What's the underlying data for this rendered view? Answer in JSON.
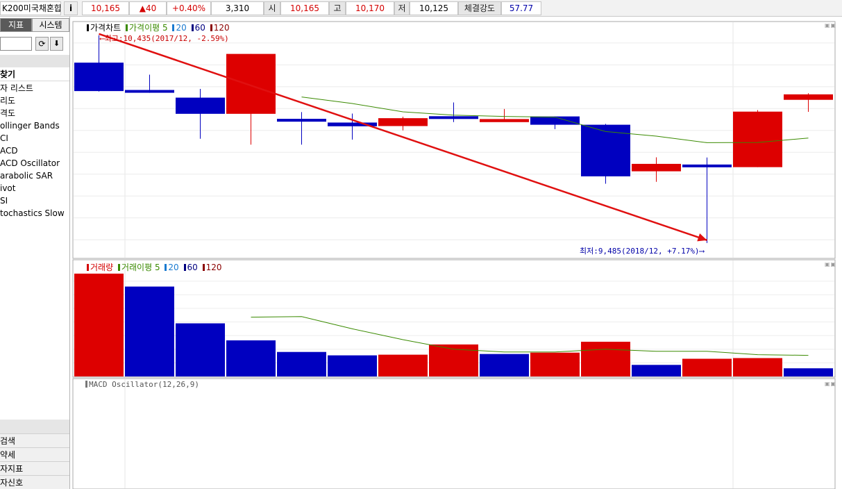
{
  "topbar": {
    "symbol": "K200미국채혼합",
    "info_button": "i",
    "price": "10,165",
    "change": "▲40",
    "change_pct": "+0.40%",
    "volume": "3,310",
    "open_label": "시",
    "open_value": "10,165",
    "high_label": "고",
    "high_value": "10,170",
    "low_label": "저",
    "low_value": "10,125",
    "strength_label": "체결강도",
    "strength_value": "57.77"
  },
  "left_panel": {
    "tabs": [
      "지표",
      "시스템"
    ],
    "section_title": "찾기",
    "items": [
      "자 리스트",
      "리도",
      "격도",
      "ollinger Bands",
      "CI",
      "ACD",
      "ACD Oscillator",
      "arabolic SAR",
      "ivot",
      "SI",
      "tochastics Slow"
    ],
    "bottom_items": [
      "검색",
      "약세",
      "자지표",
      "자신호"
    ]
  },
  "price_chart": {
    "title": "가격차트",
    "ma_label": "가격이평",
    "ma_periods": [
      "5",
      "20",
      "60",
      "120"
    ],
    "max_annotation": "최고:10,435(2017/12, -2.59%)",
    "min_annotation": "최저:9,485(2018/12, +7.17%)"
  },
  "volume_chart": {
    "title": "거래량",
    "ma_label": "거래이평",
    "ma_periods": [
      "5",
      "20",
      "60",
      "120"
    ]
  },
  "macd_chart": {
    "title": "MACD Oscillator(12,26,9)"
  },
  "colors": {
    "up": "#dd0000",
    "down": "#0000c0",
    "ma5": "#3a8a00",
    "ma20": "#1a7ad0",
    "ma60": "#000080",
    "ma120": "#8a0000",
    "trendline": "#e01010"
  },
  "chart_data": [
    {
      "type": "candlestick",
      "interval": "monthly",
      "candles": [
        {
          "open": 10310,
          "high": 10435,
          "low": 10178,
          "close": 10180
        },
        {
          "open": 10185,
          "high": 10255,
          "low": 10172,
          "close": 10173
        },
        {
          "open": 10150,
          "high": 10190,
          "low": 9962,
          "close": 10076
        },
        {
          "open": 10076,
          "high": 10350,
          "low": 9935,
          "close": 10350
        },
        {
          "open": 10053,
          "high": 10084,
          "low": 9935,
          "close": 10040
        },
        {
          "open": 10036,
          "high": 10077,
          "low": 9958,
          "close": 10019
        },
        {
          "open": 10020,
          "high": 10063,
          "low": 10000,
          "close": 10056
        },
        {
          "open": 10065,
          "high": 10128,
          "low": 10038,
          "close": 10053
        },
        {
          "open": 10038,
          "high": 10098,
          "low": 10045,
          "close": 10052
        },
        {
          "open": 10064,
          "high": 10064,
          "low": 10006,
          "close": 10026
        },
        {
          "open": 10026,
          "high": 10030,
          "low": 9756,
          "close": 9790
        },
        {
          "open": 9813,
          "high": 9877,
          "low": 9765,
          "close": 9847
        },
        {
          "open": 9844,
          "high": 9876,
          "low": 9485,
          "close": 9832
        },
        {
          "open": 9832,
          "high": 10093,
          "low": 9832,
          "close": 10086
        },
        {
          "open": 10140,
          "high": 10170,
          "low": 10085,
          "close": 10165
        }
      ],
      "ma5": [
        null,
        null,
        null,
        null,
        10153,
        10123,
        10085,
        10070,
        10064,
        10061,
        9995,
        9974,
        9944,
        9945,
        9965
      ]
    },
    {
      "type": "bar",
      "colors_by_candle": [
        "up",
        "down",
        "down",
        "down",
        "down",
        "down",
        "up",
        "up",
        "down",
        "up",
        "up",
        "down",
        "up",
        "up",
        "down"
      ],
      "values": [
        151,
        132,
        78,
        53,
        36,
        31,
        32,
        47,
        33,
        35,
        51,
        17,
        26,
        27,
        12
      ],
      "ma5": [
        null,
        null,
        null,
        87,
        88,
        70,
        54,
        40,
        36,
        36,
        40,
        37,
        37,
        32,
        31
      ]
    },
    {
      "type": "line",
      "values": []
    }
  ]
}
